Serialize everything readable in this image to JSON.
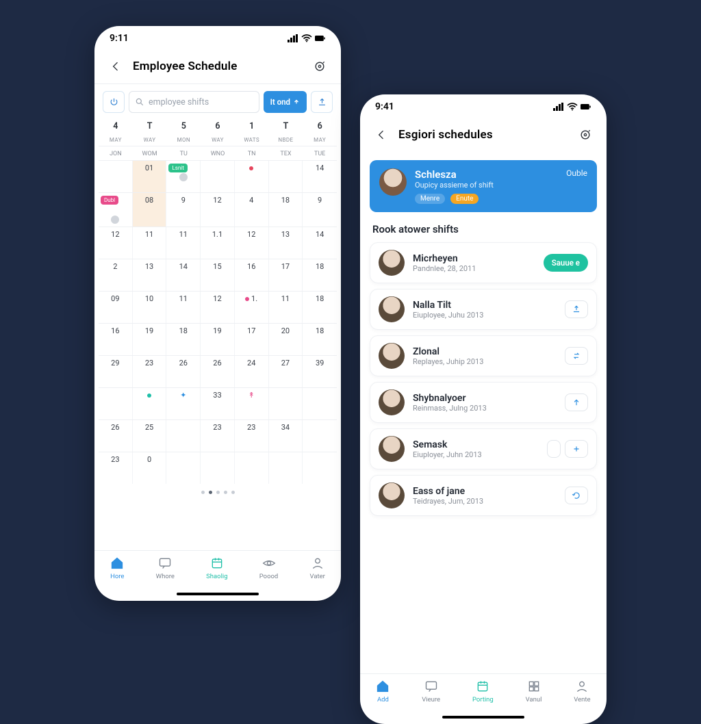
{
  "left": {
    "status_time": "9:11",
    "title": "Employee Schedule",
    "search_placeholder": "employee shifts",
    "filter_button": "It ond",
    "day_header": [
      {
        "n": "4",
        "l": "MAY"
      },
      {
        "n": "T",
        "l": "WAY"
      },
      {
        "n": "5",
        "l": "MON"
      },
      {
        "n": "6",
        "l": "WAY"
      },
      {
        "n": "1",
        "l": "WATS"
      },
      {
        "n": "T",
        "l": "NBDE"
      },
      {
        "n": "6",
        "l": "MAY"
      }
    ],
    "week_header": [
      "JON",
      "WOM",
      "TU",
      "WNO",
      "TN",
      "TEX",
      "TUE"
    ],
    "badges": {
      "lsnit": "Lsnit",
      "dubl": "Dubl"
    },
    "grid": [
      [
        "",
        "01",
        "",
        "",
        "",
        "",
        "14"
      ],
      [
        "",
        "08",
        "9",
        "12",
        "4",
        "18",
        "9"
      ],
      [
        "12",
        "11",
        "11",
        "1.1",
        "12",
        "13",
        "14"
      ],
      [
        "2",
        "13",
        "14",
        "15",
        "16",
        "17",
        "18"
      ],
      [
        "09",
        "10",
        "11",
        "12",
        "1.",
        "11",
        "18"
      ],
      [
        "16",
        "19",
        "18",
        "19",
        "17",
        "20",
        "18"
      ],
      [
        "29",
        "23",
        "26",
        "26",
        "24",
        "27",
        "39"
      ],
      [
        "",
        "",
        "",
        "33",
        "",
        "",
        ""
      ],
      [
        "26",
        "25",
        "",
        "23",
        "23",
        "34",
        ""
      ],
      [
        "23",
        "0",
        "",
        "",
        "",
        "",
        ""
      ]
    ],
    "nav": [
      {
        "label": "Hore",
        "name": "home"
      },
      {
        "label": "Whore",
        "name": "where"
      },
      {
        "label": "Shaolig",
        "name": "schedule"
      },
      {
        "label": "Poood",
        "name": "feed"
      },
      {
        "label": "Vater",
        "name": "user"
      }
    ]
  },
  "right": {
    "status_time": "9:41",
    "title": "Esgiori schedules",
    "featured": {
      "name": "Schlesza",
      "sub": "Oupicy assieme of shift",
      "meta1": "Menre",
      "meta2": "Enute",
      "action": "Ouble"
    },
    "section_title": "Rook atower shifts",
    "employees": [
      {
        "name": "Micrheyen",
        "sub": "Pandnlee, 28, 2011",
        "action_type": "pill",
        "action_label": "Sauue e"
      },
      {
        "name": "Nalla Tilt",
        "sub": "Eiuployee, Juhu 2013",
        "action_type": "chip",
        "icon": "share"
      },
      {
        "name": "Zlonal",
        "sub": "Replayes, Juhip 2013",
        "action_type": "chip",
        "icon": "swap"
      },
      {
        "name": "Shybnalyoer",
        "sub": "Reinmass, Julng 2013",
        "action_type": "chip",
        "icon": "up"
      },
      {
        "name": "Semask",
        "sub": "Eiuployer, Juhn 2013",
        "action_type": "chip-pair",
        "icon": "plus"
      },
      {
        "name": "Eass of jane",
        "sub": "Teidrayes, Jum, 2013",
        "action_type": "chip",
        "icon": "refresh"
      }
    ],
    "nav": [
      {
        "label": "Add",
        "name": "home"
      },
      {
        "label": "Vieure",
        "name": "where"
      },
      {
        "label": "Porting",
        "name": "schedule"
      },
      {
        "label": "Vanul",
        "name": "feed"
      },
      {
        "label": "Vente",
        "name": "user"
      }
    ]
  }
}
